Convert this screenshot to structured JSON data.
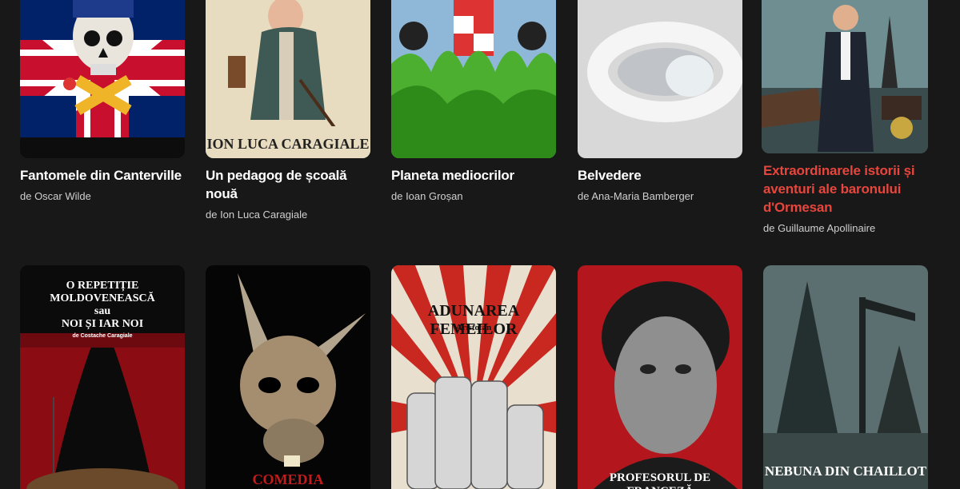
{
  "row1": [
    {
      "title": "Fantomele din Canterville",
      "author": "de Oscar Wilde",
      "accent": false,
      "icon": "skull-flag-icon"
    },
    {
      "title": "Un pedagog de școală nouă",
      "author": "de Ion Luca Caragiale",
      "accent": false,
      "cover_text": "ION LUCA CARAGIALE",
      "icon": "caricature-icon"
    },
    {
      "title": "Planeta mediocrilor",
      "author": "de Ioan Groșan",
      "accent": false,
      "icon": "rocket-grass-icon"
    },
    {
      "title": "Belvedere",
      "author": "de Ana-Maria Bamberger",
      "accent": false,
      "icon": "mobius-ribbon-icon"
    },
    {
      "title": "Extraordinarele istorii și aventuri ale baronului d'Ormesan",
      "author": "de Guillaume Apollinaire",
      "accent": true,
      "icon": "baron-eiffel-icon"
    }
  ],
  "row2": [
    {
      "cover_text_lines": [
        "O REPETIȚIE MOLDOVENEASCĂ",
        "sau",
        "NOI ȘI IAR NOI"
      ],
      "cover_subtitle": "de Costache Caragiale",
      "icon": "theater-curtain-icon"
    },
    {
      "cover_text": "COMEDIA MĂGARILOR",
      "icon": "donkey-mask-icon"
    },
    {
      "cover_text": "ADUNAREA FEMEILOR",
      "cover_subtitle": "Aristofan",
      "icon": "raised-fists-icon"
    },
    {
      "cover_text": "PROFESORUL DE FRANCEZĂ",
      "icon": "portrait-icon"
    },
    {
      "cover_text": "NEBUNA DIN CHAILLOT",
      "icon": "eiffel-oil-pump-icon"
    }
  ],
  "colors": {
    "background": "#181818",
    "accent": "#e8453c",
    "text": "#ffffff",
    "muted": "#cfcfcf"
  }
}
